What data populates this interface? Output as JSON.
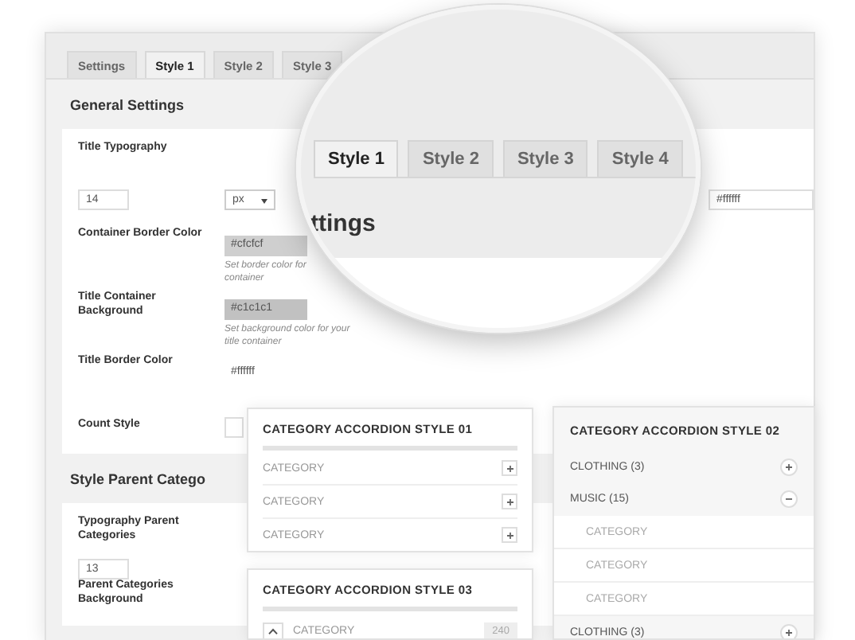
{
  "tabs": [
    {
      "label": "Settings",
      "selected": false
    },
    {
      "label": "Style 1",
      "selected": true
    },
    {
      "label": "Style 2",
      "selected": false
    },
    {
      "label": "Style 3",
      "selected": false
    }
  ],
  "sections": [
    {
      "title": "General Settings",
      "rows": [
        {
          "kind": "typography",
          "label": "Title Typography",
          "size": "14",
          "unit": "px",
          "color": "#ffffff"
        },
        {
          "kind": "color",
          "label": "Container Border Color",
          "value": "#cfcfcf",
          "help": "Set border color for\ncontainer"
        },
        {
          "kind": "color",
          "label": "Title Container Background",
          "value": "#c1c1c1",
          "help": "Set background color for your\ntitle container"
        },
        {
          "kind": "color",
          "label": "Title Border Color",
          "value": "#ffffff"
        },
        {
          "kind": "select",
          "label": "Count Style"
        }
      ]
    },
    {
      "title": "Style Parent Catego",
      "rows": [
        {
          "kind": "size",
          "label": "Typography Parent Categories",
          "size": "13"
        },
        {
          "kind": "label",
          "label": "Parent Categories Background"
        }
      ]
    }
  ],
  "magnifier": {
    "tabs": [
      {
        "label": "Style 1",
        "selected": true
      },
      {
        "label": "Style 2",
        "selected": false
      },
      {
        "label": "Style 3",
        "selected": false
      },
      {
        "label": "Style 4",
        "selected": false
      }
    ],
    "heading": "ttings"
  },
  "accordions": [
    {
      "kind": "boxed",
      "title": "CATEGORY ACCORDION STYLE 01",
      "items": [
        {
          "label": "CATEGORY",
          "expanded": false
        },
        {
          "label": "CATEGORY",
          "expanded": false
        },
        {
          "label": "CATEGORY",
          "expanded": false
        }
      ]
    },
    {
      "kind": "counted",
      "title": "CATEGORY ACCORDION STYLE 03",
      "items": [
        {
          "label": "CATEGORY",
          "count": "240",
          "expanded": true
        }
      ]
    },
    {
      "kind": "tree",
      "title": "CATEGORY ACCORDION STYLE 02",
      "items": [
        {
          "label": "CLOTHING (3)",
          "expanded": false
        },
        {
          "label": "MUSIC (15)",
          "expanded": true,
          "children": [
            {
              "label": "CATEGORY"
            },
            {
              "label": "CATEGORY"
            },
            {
              "label": "CATEGORY"
            }
          ]
        },
        {
          "label": "CLOTHING (3)",
          "expanded": false
        }
      ]
    }
  ]
}
